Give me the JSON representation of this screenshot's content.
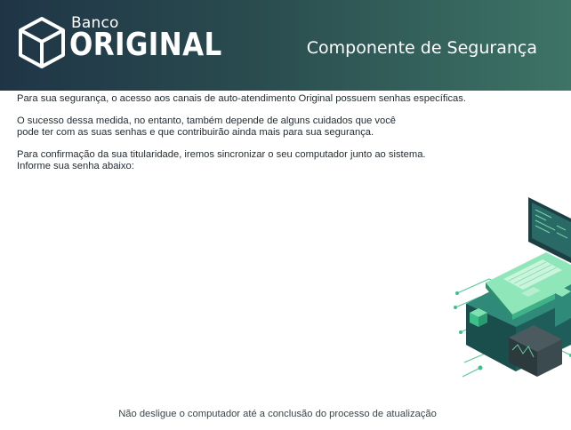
{
  "header": {
    "brand_top": "Banco",
    "brand_main": "ORIGINAL",
    "title": "Componente de Segurança"
  },
  "content": {
    "paragraph1": "Para sua segurança, o acesso aos canais de auto-atendimento Original possuem senhas específicas.",
    "paragraph2_line1": "O sucesso dessa medida, no entanto, também depende de alguns cuidados que você",
    "paragraph2_line2": "pode ter com as suas senhas e que contribuirão ainda mais para sua segurança.",
    "paragraph3_line1": "Para confirmação da sua titularidade, iremos sincronizar o seu computador junto ao sistema.",
    "paragraph3_line2": "Informe sua senha abaixo:"
  },
  "footer": {
    "note": "Não desligue o computador até a conclusão do processo de atualização"
  },
  "colors": {
    "header_start": "#1f3546",
    "header_end": "#3d7466",
    "accent_green": "#3cc08a"
  },
  "icons": {
    "logo": "cube-logo-icon",
    "illustration": "isometric-laptop-circuit-illustration"
  }
}
